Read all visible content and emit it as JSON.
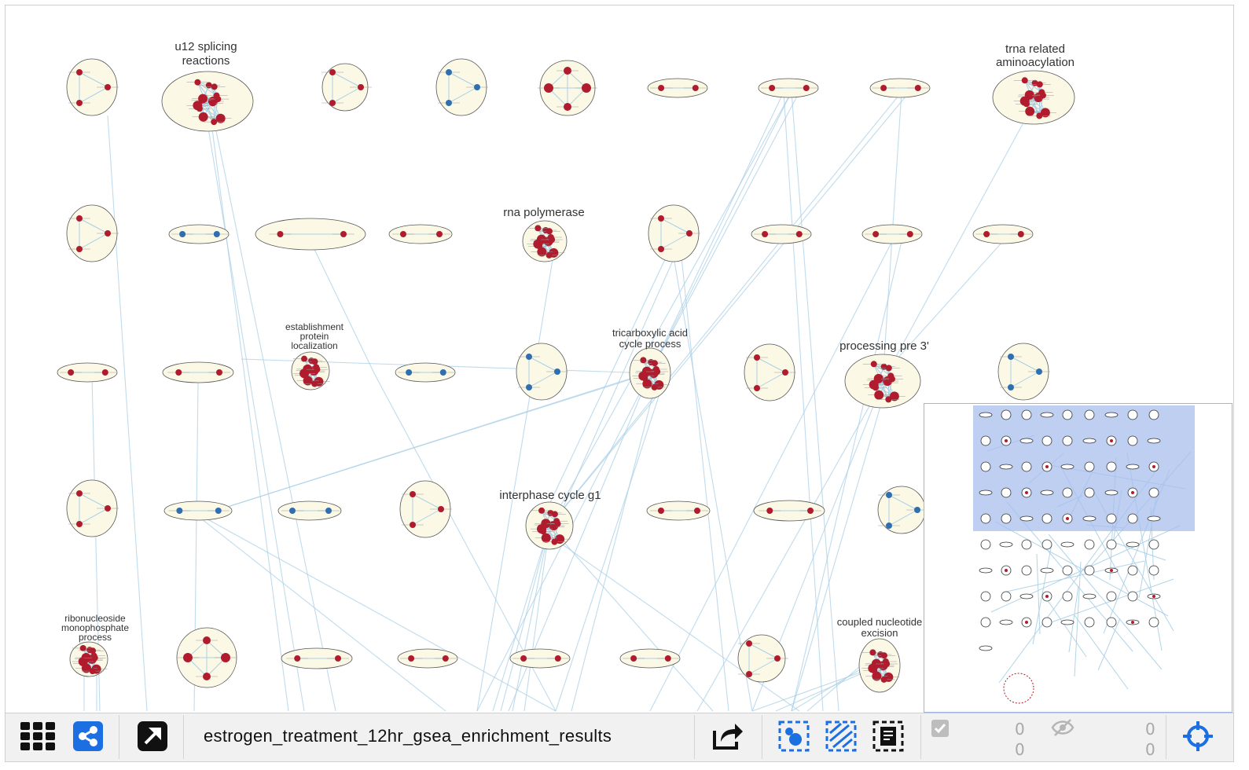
{
  "network": {
    "title": "estrogen_treatment_12hr_gsea_enrichment_results",
    "cluster_labels": {
      "u12": [
        "u12 splicing",
        "reactions"
      ],
      "trna": [
        "trna related",
        "aminoacylation"
      ],
      "rnapol": "rna polymerase",
      "establishment": [
        "establishment",
        "protein",
        "localization"
      ],
      "tricarboxylic": [
        "tricarboxylic acid",
        "cycle process"
      ],
      "processing": "processing pre 3'",
      "interphase": "interphase cycle g1",
      "ribonucleoside": [
        "ribonucleoside",
        "monophosphate",
        "process"
      ],
      "coupled": [
        "coupled nucleotide",
        "excision"
      ]
    }
  },
  "toolbar": {
    "selected_nodes": "0",
    "hidden_nodes": "0",
    "selected_edges": "0",
    "hidden_edges": "0"
  },
  "colors": {
    "node_red": "#b01c2e",
    "node_blue": "#2f6fb0",
    "cluster_fill": "#fbf9e6",
    "edge": "#a9cfe6",
    "accent_blue": "#1c6fe0",
    "viewport": "#a8bfee"
  },
  "icons": {
    "apps": "grid-icon",
    "share": "share-icon",
    "detach": "external-link-icon",
    "export": "export-icon",
    "select_nodes": "select-nodes-icon",
    "select_edges": "select-edges-icon",
    "select_annotations": "select-annotations-icon",
    "check": "check-icon",
    "hidden": "eye-slash-icon",
    "fit": "crosshair-icon"
  }
}
